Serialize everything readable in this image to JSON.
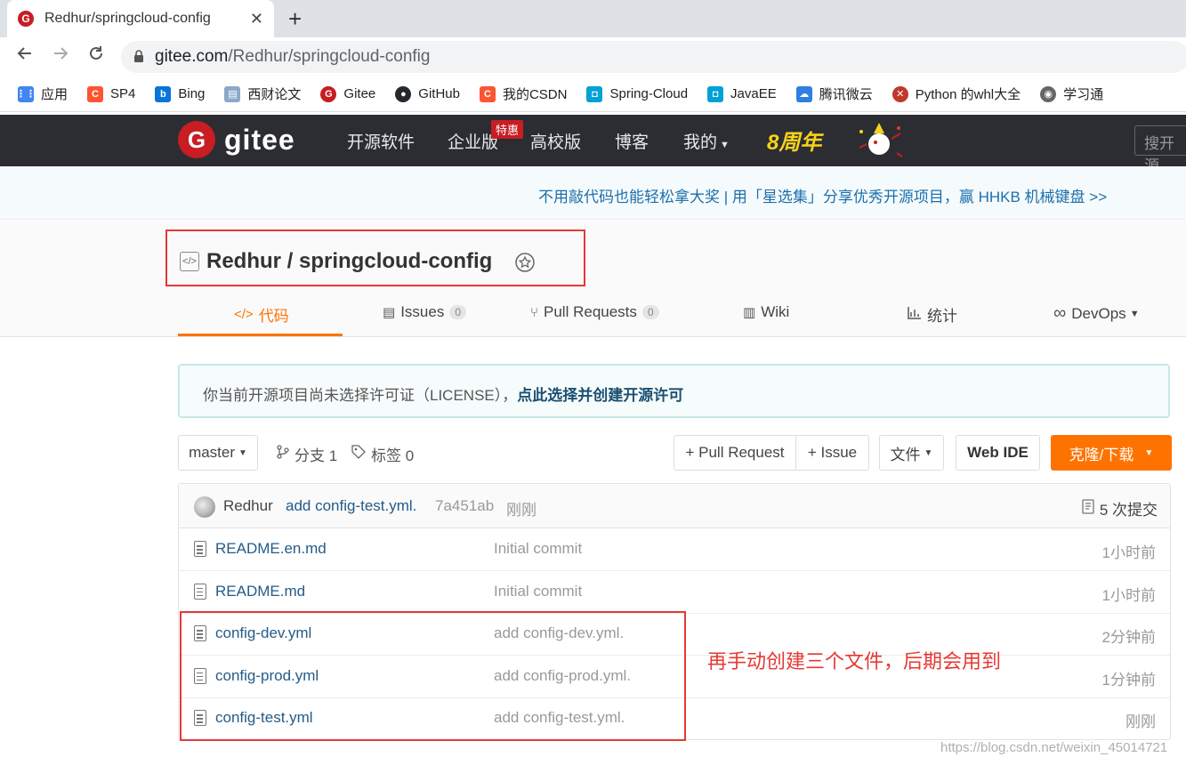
{
  "browser": {
    "tab_title": "Redhur/springcloud-config",
    "new_tab_label": "+",
    "close_label": "✕",
    "url_host": "gitee.com",
    "url_path": "/Redhur/springcloud-config",
    "bookmarks": [
      {
        "label": "应用",
        "icon": "apps-grid-icon",
        "color": "#4285f4"
      },
      {
        "label": "SP4",
        "icon": "csdn-icon",
        "color": "#fc5531"
      },
      {
        "label": "Bing",
        "icon": "bing-icon",
        "color": "#0a74d8"
      },
      {
        "label": "西财论文",
        "icon": "document-icon",
        "color": "#8aa8c8"
      },
      {
        "label": "Gitee",
        "icon": "gitee-icon",
        "color": "#c71d23"
      },
      {
        "label": "GitHub",
        "icon": "github-icon",
        "color": "#24292e"
      },
      {
        "label": "我的CSDN",
        "icon": "csdn-icon",
        "color": "#fc5531"
      },
      {
        "label": "Spring-Cloud",
        "icon": "bilibili-icon",
        "color": "#00a1d6"
      },
      {
        "label": "JavaEE",
        "icon": "bilibili-icon",
        "color": "#00a1d6"
      },
      {
        "label": "腾讯微云",
        "icon": "weiyun-icon",
        "color": "#2f7fe0"
      },
      {
        "label": "Python 的whl大全",
        "icon": "python-icon",
        "color": "#c0392b"
      },
      {
        "label": "学习通",
        "icon": "globe-icon",
        "color": "#666666"
      }
    ]
  },
  "gitee": {
    "logo_text": "gitee",
    "nav": [
      "开源软件",
      "企业版",
      "高校版",
      "博客",
      "我的"
    ],
    "special_badge": "特惠",
    "anniversary": "8周年",
    "search_placeholder": "搜开源"
  },
  "promo": {
    "text": "不用敲代码也能轻松拿大奖 | 用「星选集」分享优秀开源项目，赢 HHKB 机械键盘 >>"
  },
  "project": {
    "title": "Redhur / springcloud-config",
    "tabs": [
      {
        "label": "代码",
        "count": null,
        "active": true
      },
      {
        "label": "Issues",
        "count": "0"
      },
      {
        "label": "Pull Requests",
        "count": "0"
      },
      {
        "label": "Wiki",
        "count": null
      },
      {
        "label": "统计",
        "count": null
      },
      {
        "label": "DevOps",
        "count": null
      }
    ]
  },
  "license": {
    "text": "你当前开源项目尚未选择许可证（LICENSE），",
    "link": "点此选择并创建开源许可"
  },
  "branch_bar": {
    "branch": "master",
    "branches": "分支 1",
    "tags": "标签 0",
    "pull_request": "+ Pull Request",
    "issue": "+ Issue",
    "file_menu": "文件",
    "web_ide": "Web IDE",
    "clone": "克隆/下载"
  },
  "last_commit": {
    "author": "Redhur",
    "message": "add config-test.yml.",
    "hash": "7a451ab",
    "time": "刚刚",
    "commits": "5 次提交"
  },
  "files": [
    {
      "name": "README.en.md",
      "message": "Initial commit",
      "time": "1小时前"
    },
    {
      "name": "README.md",
      "message": "Initial commit",
      "time": "1小时前"
    },
    {
      "name": "config-dev.yml",
      "message": "add config-dev.yml.",
      "time": "2分钟前"
    },
    {
      "name": "config-prod.yml",
      "message": "add config-prod.yml.",
      "time": "1分钟前"
    },
    {
      "name": "config-test.yml",
      "message": "add config-test.yml.",
      "time": "刚刚"
    }
  ],
  "annotation": "再手动创建三个文件，后期会用到",
  "watermark": "https://blog.csdn.net/weixin_45014721",
  "colors": {
    "gitee_red": "#c71d23",
    "accent_orange": "#fe7300",
    "annotation_red": "#e53935",
    "header_dark": "#2b2d33"
  }
}
